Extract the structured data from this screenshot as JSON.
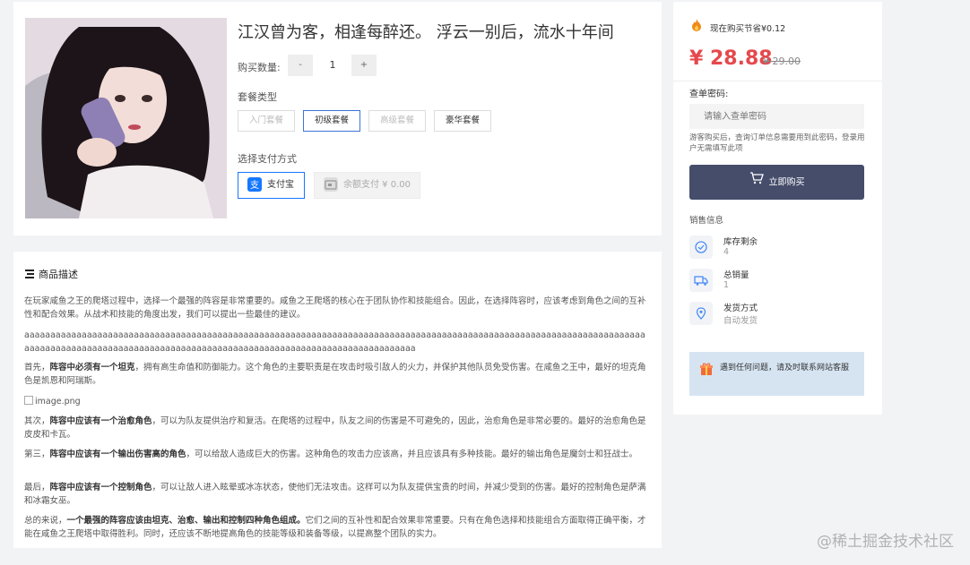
{
  "product": {
    "title": "江汉曾为客，相逢每醉还。 浮云一别后，流水十年间",
    "qty_label": "购买数量:",
    "qty_minus": "-",
    "qty_value": "1",
    "qty_plus": "+",
    "package_label": "套餐类型",
    "packages": [
      "入门套餐",
      "初级套餐",
      "高级套餐",
      "豪华套餐"
    ],
    "selected_package": "初级套餐",
    "pay_label": "选择支付方式",
    "pay_alipay": "支付宝",
    "pay_balance": "余额支付 ¥ 0.00",
    "colors": {
      "alipay": "#1677ff",
      "selected_border": "#3c74d8"
    }
  },
  "sidebar": {
    "promo": "现在购买节省¥0.12",
    "price": "¥ 28.88",
    "old_price": "¥ 29.00",
    "query_label": "查单密码:",
    "query_placeholder": "请输入查单密码",
    "query_note": "游客购买后，查询订单信息需要用到此密码，登录用户无需填写此项",
    "buy_button": "立即购买",
    "sales_label": "销售信息",
    "stats": [
      {
        "icon": "check-circle-icon",
        "label": "库存剩余",
        "value": "4"
      },
      {
        "icon": "truck-icon",
        "label": "总销量",
        "value": "1"
      },
      {
        "icon": "location-pin-icon",
        "label": "发货方式",
        "value": "自动发货"
      }
    ],
    "contact_text": "遇到任何问题，请及时联系网站客服",
    "colors": {
      "price": "#e5484d",
      "buy_button": "#454d6b",
      "contact_bg": "#d6e4f2"
    }
  },
  "description": {
    "heading": "商品描述",
    "p1": "在玩家咸鱼之王的爬塔过程中，选择一个最强的阵容是非常重要的。咸鱼之王爬塔的核心在于团队协作和技能组合。因此，在选择阵容时，应该考虑到角色之间的互补性和配合效果。从战术和技能的角度出发，我们可以提出一些最佳的建议。",
    "p2": "aaaaaaaaaaaaaaaaaaaaaaaaaaaaaaaaaaaaaaaaaaaaaaaaaaaaaaaaaaaaaaaaaaaaaaaaaaaaaaaaaaaaaaaaaaaaaaaaaaaaaaaaaaaaaaaaaaaaaaaaaaaaaaaaaaaaaaaaaaaaaaaaaaaaaaaaaaaaaaaaaaaaaaaaaaaaaaaaaaaaaaaaaaaaaaaaaa",
    "p3_a": "首先，",
    "p3_b": "阵容中必须有一个坦克",
    "p3_c": "，拥有高生命值和防御能力。这个角色的主要职责是在攻击时吸引敌人的火力，并保护其他队员免受伤害。在咸鱼之王中，最好的坦克角色是凯恩和阿瑞斯。",
    "img_alt": "image.png",
    "p4_a": "其次，",
    "p4_b": "阵容中应该有一个治愈角色",
    "p4_c": "，可以为队友提供治疗和复活。在爬塔的过程中，队友之间的伤害是不可避免的，因此，治愈角色是非常必要的。最好的治愈角色是皮皮和卡瓦。",
    "p5_a": "第三，",
    "p5_b": "阵容中应该有一个输出伤害高的角色",
    "p5_c": "，可以给敌人造成巨大的伤害。这种角色的攻击力应该高，并且应该具有多种技能。最好的输出角色是魔剑士和狂战士。",
    "p6_a": "最后，",
    "p6_b": "阵容中应该有一个控制角色",
    "p6_c": "，可以让敌人进入眩晕或冰冻状态，使他们无法攻击。这样可以为队友提供宝贵的时间，并减少受到的伤害。最好的控制角色是萨满和冰霜女巫。",
    "p7_a": "总的来说，",
    "p7_b": "一个最强的阵容应该由坦克、治愈、输出和控制四种角色组成。",
    "p7_c": "它们之间的互补性和配合效果非常重要。只有在角色选择和技能组合方面取得正确平衡，才能在咸鱼之王爬塔中取得胜利。同时，还应该不断地提高角色的技能等级和装备等级，以提高整个团队的实力。"
  },
  "watermark": "@稀土掘金技术社区"
}
